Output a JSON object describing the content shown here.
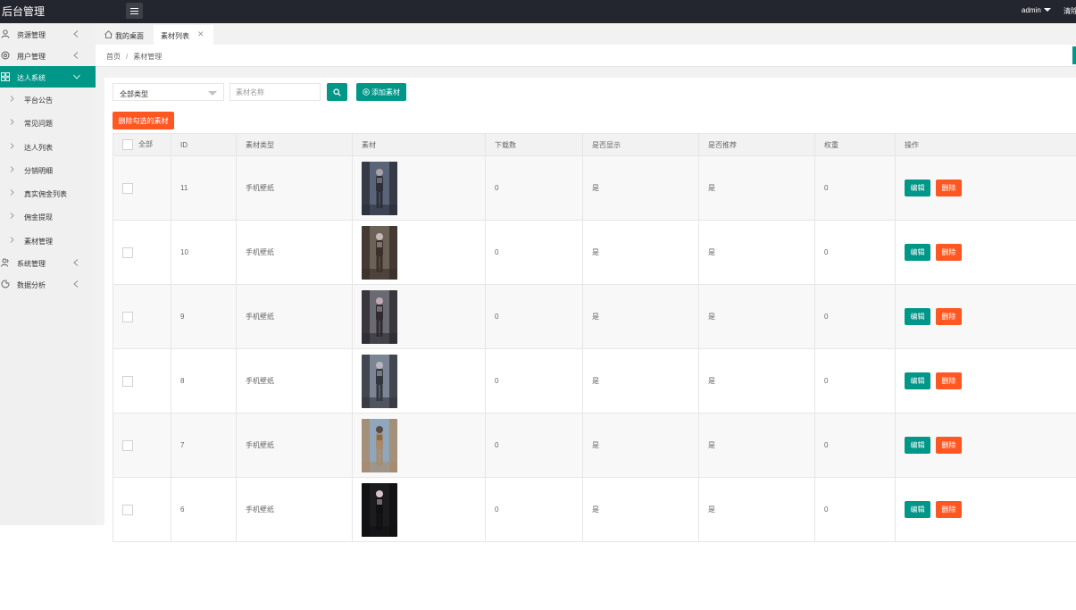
{
  "app": {
    "title": "后台管理",
    "user": "admin",
    "topbar_extra": "清除"
  },
  "sidebar": {
    "items": [
      {
        "label": "资源管理",
        "icon": "user-icon"
      },
      {
        "label": "用户管理",
        "icon": "settings-icon"
      },
      {
        "label": "达人系统",
        "icon": "grid-icon",
        "active": true
      },
      {
        "label": "系统管理",
        "icon": "users-icon"
      },
      {
        "label": "数据分析",
        "icon": "chart-icon"
      }
    ],
    "subitems": [
      "平台公告",
      "常见问题",
      "达人列表",
      "分销明细",
      "真实佣金列表",
      "佣金提现",
      "素材管理"
    ]
  },
  "tabs": [
    {
      "label": "我的桌面"
    },
    {
      "label": "素材列表"
    }
  ],
  "breadcrumb": {
    "home": "首页",
    "sep": "/",
    "current": "素材管理"
  },
  "filters": {
    "type_select": "全部类型",
    "name_placeholder": "素材名称",
    "add_button": "添加素材",
    "delete_selected_button": "删除勾选的素材"
  },
  "table": {
    "headers": {
      "all": "全部",
      "id": "ID",
      "type": "素材类型",
      "material": "素材",
      "downloads": "下载数",
      "shown": "是否显示",
      "recommended": "是否推荐",
      "weight": "权重",
      "actions": "操作"
    },
    "edit_label": "编辑",
    "delete_label": "删除",
    "rows": [
      {
        "id": "11",
        "type": "手机壁纸",
        "downloads": "0",
        "shown": "是",
        "recommended": "是",
        "weight": "0",
        "thumb_colors": [
          "#5a6478",
          "#2c2f3a",
          "#a9a2a8"
        ]
      },
      {
        "id": "10",
        "type": "手机壁纸",
        "downloads": "0",
        "shown": "是",
        "recommended": "是",
        "weight": "0",
        "thumb_colors": [
          "#6d6257",
          "#3a2f2a",
          "#c8b6b9"
        ]
      },
      {
        "id": "9",
        "type": "手机壁纸",
        "downloads": "0",
        "shown": "是",
        "recommended": "是",
        "weight": "0",
        "thumb_colors": [
          "#6a6a72",
          "#2d2a30",
          "#c3a8b8"
        ]
      },
      {
        "id": "8",
        "type": "手机壁纸",
        "downloads": "0",
        "shown": "是",
        "recommended": "是",
        "weight": "0",
        "thumb_colors": [
          "#7b8594",
          "#33363d",
          "#b9b6bf"
        ]
      },
      {
        "id": "7",
        "type": "手机壁纸",
        "downloads": "0",
        "shown": "是",
        "recommended": "是",
        "weight": "0",
        "thumb_colors": [
          "#8fa6bb",
          "#a88a6a",
          "#5a4a44"
        ]
      },
      {
        "id": "6",
        "type": "手机壁纸",
        "downloads": "0",
        "shown": "是",
        "recommended": "是",
        "weight": "0",
        "thumb_colors": [
          "#1c1c1f",
          "#101012",
          "#d8c4c8"
        ]
      }
    ]
  },
  "colors": {
    "primary": "#009688",
    "danger": "#ff5722",
    "topbar": "#23262e"
  }
}
